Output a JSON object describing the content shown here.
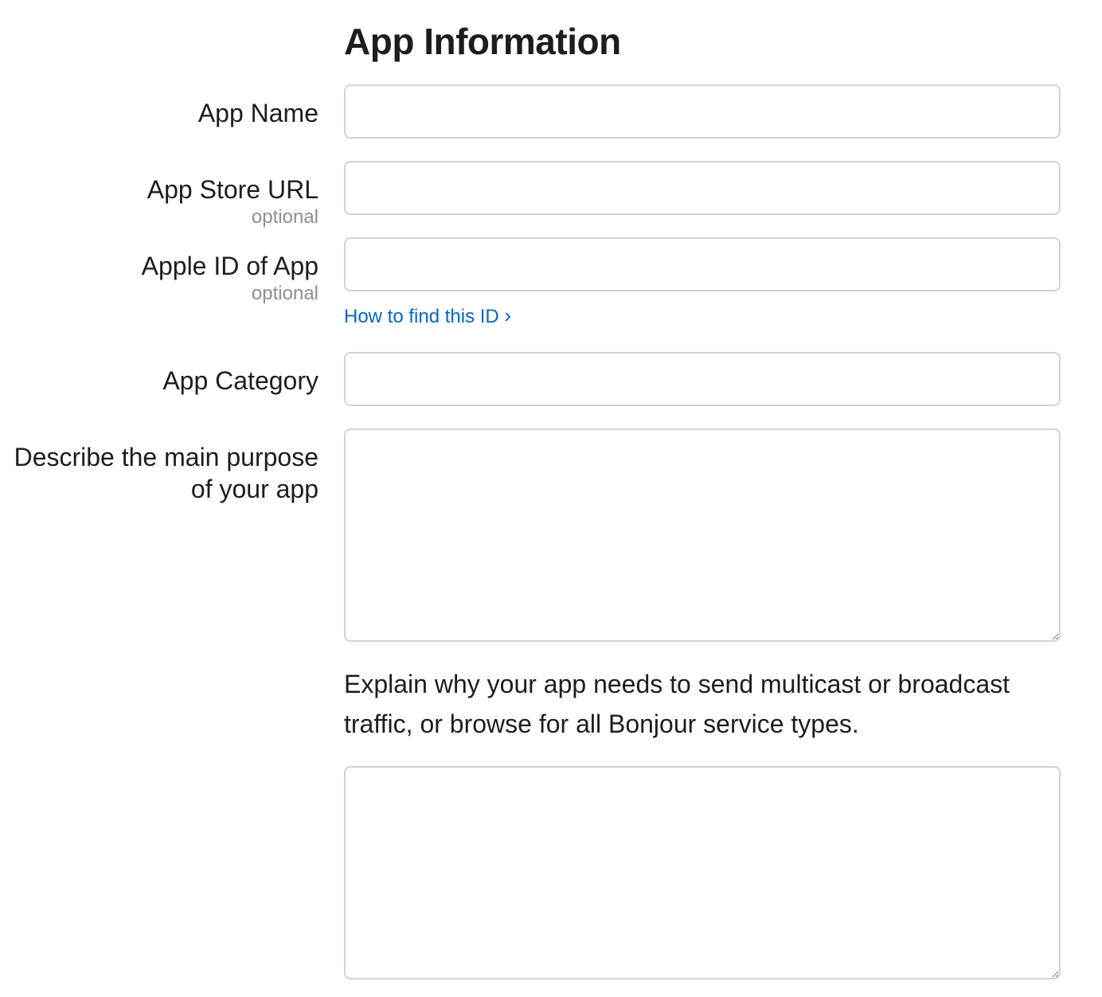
{
  "section": {
    "title": "App Information"
  },
  "fields": {
    "app_name": {
      "label": "App Name",
      "value": ""
    },
    "app_store_url": {
      "label": "App Store URL",
      "sublabel": "optional",
      "value": ""
    },
    "apple_id": {
      "label": "Apple ID of App",
      "sublabel": "optional",
      "value": ""
    },
    "app_category": {
      "label": "App Category",
      "value": ""
    },
    "purpose": {
      "label_line1": "Describe the main purpose",
      "label_line2": "of your app",
      "value": ""
    },
    "multicast_reason": {
      "value": ""
    }
  },
  "links": {
    "find_id": "How to find this ID",
    "find_id_chevron": "›"
  },
  "explanation": "Explain why your app needs to send multicast or broadcast traffic, or browse for all Bonjour service types."
}
